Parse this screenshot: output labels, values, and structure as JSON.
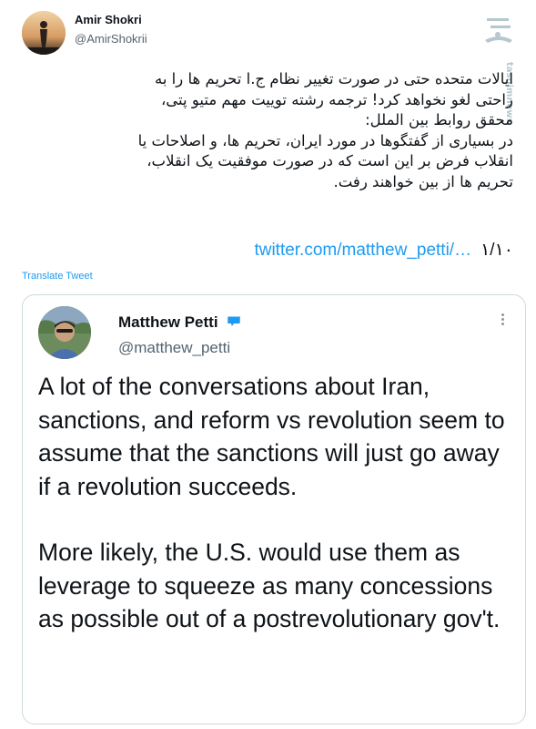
{
  "author": {
    "name": "Amir Shokri",
    "handle": "@AmirShokrii"
  },
  "tweet": {
    "lines": [
      "ایالات متحده حتی در صورت تغییر نظام ج.ا تحریم ها را به",
      "راحتی لغو نخواهد کرد! ترجمه رشته توییت مهم متیو پتی،",
      "محقق روابط بین الملل:",
      "در بسیاری از گفتگوها در مورد ایران، تحریم ها، و اصلاحات یا",
      "انقلاب فرض بر این است که در صورت موفقیت یک انقلاب،",
      "تحریم ها از بین خواهند رفت."
    ],
    "link_text": "twitter.com/matthew_petti/…",
    "thread_count": "۱/۱۰",
    "translate_label": "Translate Tweet"
  },
  "quote": {
    "name": "Matthew Petti",
    "handle": "@matthew_petti",
    "paragraphs": [
      "A lot of the conversations about Iran, sanctions, and reform vs revolution seem to assume that the sanctions will just go away if a revolution succeeds.",
      "More likely, the U.S. would use them as leverage to squeeze as many concessions as possible out of a postrevolutionary gov't."
    ]
  },
  "colors": {
    "accent": "#1d9bf0",
    "text": "#0f1419",
    "secondary": "#536471",
    "border": "#cfd9de"
  },
  "icons": [
    "avatar",
    "verified-badge-icon",
    "more-options-icon",
    "news-agency-watermark-logo"
  ]
}
